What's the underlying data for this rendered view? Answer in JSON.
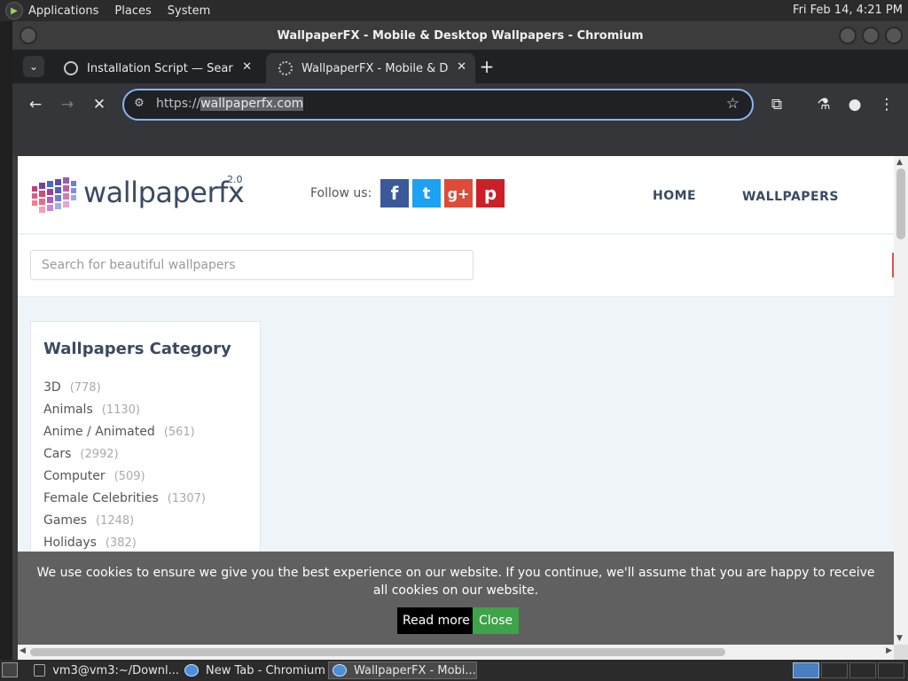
{
  "top_panel": {
    "menus": [
      "Applications",
      "Places",
      "System"
    ],
    "clock": "Fri Feb 14,  4:21 PM"
  },
  "window": {
    "title": "WallpaperFX - Mobile & Desktop Wallpapers - Chromium"
  },
  "tabs": [
    {
      "label": "Installation Script — SearXNG",
      "close": "✕"
    },
    {
      "label": "WallpaperFX - Mobile & Desktop Wallpapers",
      "close": "✕"
    }
  ],
  "toolbar": {
    "url_scheme": "https://",
    "url_host": "wallpaperfx.com"
  },
  "site": {
    "logo_text": "wallpaperfx",
    "logo_version": "2.0",
    "follow_label": "Follow us:",
    "social": [
      "f",
      "t",
      "g+",
      "p"
    ],
    "nav": {
      "home": "HOME",
      "wallpapers": "WALLPAPERS"
    },
    "search_placeholder": "Search for beautiful wallpapers",
    "category_title": "Wallpapers Category",
    "categories": [
      {
        "name": "3D",
        "count": "(778)"
      },
      {
        "name": "Animals",
        "count": "(1130)"
      },
      {
        "name": "Anime / Animated",
        "count": "(561)"
      },
      {
        "name": "Cars",
        "count": "(2992)"
      },
      {
        "name": "Computer",
        "count": "(509)"
      },
      {
        "name": "Female Celebrities",
        "count": "(1307)"
      },
      {
        "name": "Games",
        "count": "(1248)"
      },
      {
        "name": "Holidays",
        "count": "(382)"
      }
    ]
  },
  "cookie": {
    "text": "We use cookies to ensure we give you the best experience on our website. If you continue, we'll assume that you are happy to receive all cookies on our website.",
    "read_more": "Read more",
    "close": "Close"
  },
  "taskbar": {
    "tasks": [
      "vm3@vm3:~/Downl...",
      "New Tab - Chromium",
      "WallpaperFX - Mobi..."
    ]
  },
  "colors": {
    "accent": "#8ab4f8",
    "facebook": "#3b5998",
    "twitter": "#1da1f2",
    "googleplus": "#dd4b39",
    "pinterest": "#cb2027",
    "cookie_close": "#3ea44a"
  }
}
